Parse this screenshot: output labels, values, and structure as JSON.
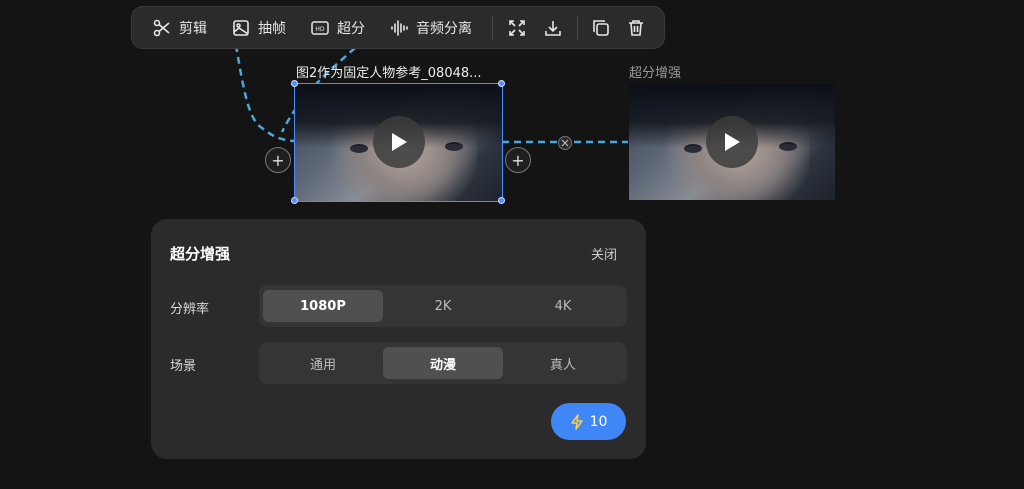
{
  "toolbar": {
    "cut_label": "剪辑",
    "frame_label": "抽帧",
    "upscale_label": "超分",
    "audio_split_label": "音频分离",
    "hd_badge": "HD"
  },
  "nodes": {
    "source_title": "图2作为固定人物参考_08048...",
    "result_title": "超分增强"
  },
  "panel": {
    "title": "超分增强",
    "close_label": "关闭",
    "resolution_label": "分辨率",
    "resolution_options": [
      "1080P",
      "2K",
      "4K"
    ],
    "resolution_selected": "1080P",
    "scene_label": "场景",
    "scene_options": [
      "通用",
      "动漫",
      "真人"
    ],
    "scene_selected": "动漫",
    "generate_cost": "10"
  },
  "colors": {
    "accent": "#3f86f6",
    "connector": "#4aa8e0",
    "background": "#141414",
    "panel": "#2b2b2b"
  }
}
